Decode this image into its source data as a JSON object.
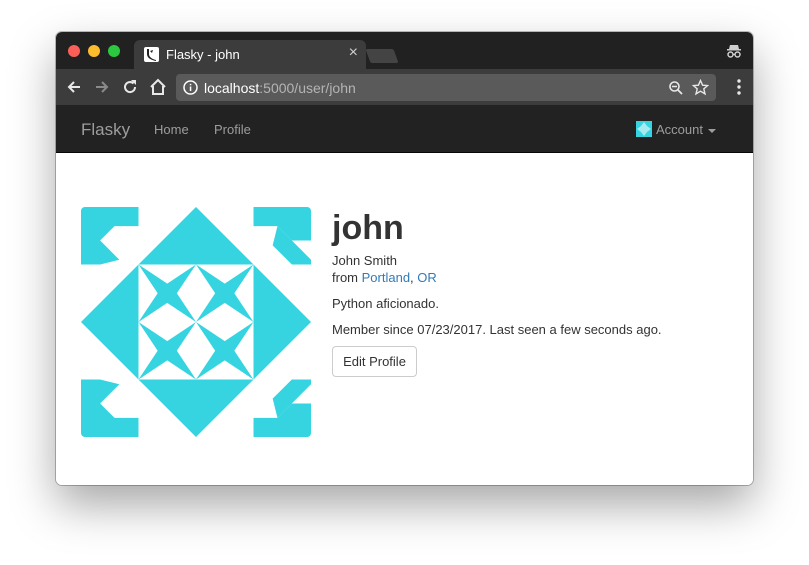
{
  "browser": {
    "tab_title": "Flasky - john",
    "tab_close": "×",
    "url_host": "localhost",
    "url_rest": ":5000/user/john"
  },
  "navbar": {
    "brand": "Flasky",
    "links": [
      "Home",
      "Profile"
    ],
    "account_label": "Account"
  },
  "profile": {
    "username": "john",
    "full_name": "John Smith",
    "location_prefix": "from ",
    "location_city": "Portland",
    "location_sep": ", ",
    "location_state": "OR",
    "about": "Python aficionado.",
    "member_since": "Member since 07/23/2017. Last seen a few seconds ago.",
    "edit_button": "Edit Profile"
  },
  "colors": {
    "identicon": "#35d4e0",
    "navbar_bg": "#222222",
    "link": "#337ab7"
  },
  "icons": {
    "back": "arrow-left-icon",
    "forward": "arrow-right-icon",
    "reload": "reload-icon",
    "home": "home-icon",
    "info": "info-icon",
    "zoom": "zoom-icon",
    "star": "star-icon",
    "menu": "menu-dots-icon",
    "incognito": "incognito-icon"
  }
}
